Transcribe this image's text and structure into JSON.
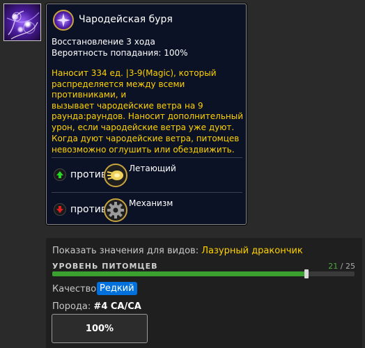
{
  "ability": {
    "title": "Чародейская буря",
    "cooldown": "Восстановление 3 хода",
    "hit_chance": "Вероятность попадания: 100%",
    "description_lines": [
      "Наносит 334 ед. |3-9(Magic), который",
      "распределяется между всеми противниками, и",
      "вызывает чародейские ветра на 9",
      "раунда:раундов. Наносит дополнительный",
      "урон, если чародейские ветра уже дуют."
    ],
    "note_lines": [
      "Когда дуют чародейские ветра, питомцев",
      "невозможно оглушить или обездвижить."
    ]
  },
  "matchups": [
    {
      "arrow": "up",
      "arrow_color": "#2bd62b",
      "label": "против",
      "type": "Летающий",
      "type_icon": "wing-icon"
    },
    {
      "arrow": "down",
      "arrow_color": "#e02020",
      "label": "против",
      "type": "Механизм",
      "type_icon": "gear-icon"
    }
  ],
  "panel": {
    "show_values_label": "Показать значения для видов:",
    "species": "Лазурный дракончик",
    "level_label": "УРОВЕНЬ ПИТОМЦЕВ",
    "level_current": "21",
    "level_max": "/ 25",
    "level_fraction": 0.84,
    "quality_label": "Качество:",
    "quality_value": "Редкий",
    "quality_color": "#0070dd",
    "breed_label": "Порода:",
    "breed_value": "#4 СА/СА",
    "percent_button": "100%"
  }
}
